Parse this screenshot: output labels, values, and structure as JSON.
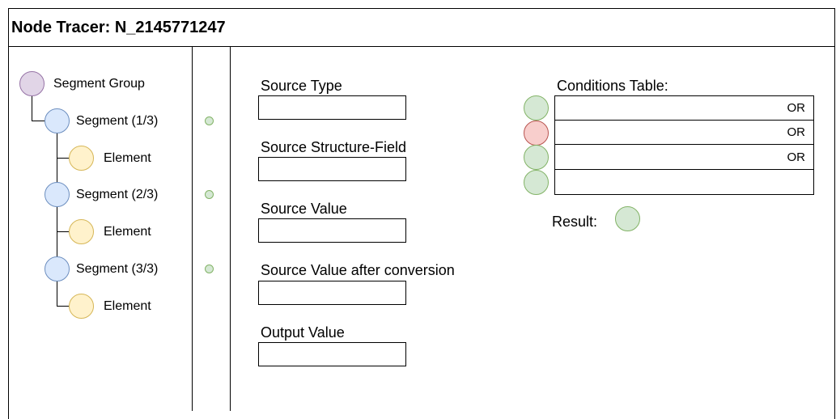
{
  "title": "Node Tracer: N_2145771247",
  "tree": {
    "group": {
      "label": "Segment Group",
      "color": "#e1d5e7",
      "icon": "group-node-icon"
    },
    "segments": [
      {
        "label": "Segment (1/3)",
        "element_label": "Element",
        "status": "green"
      },
      {
        "label": "Segment (2/3)",
        "element_label": "Element",
        "status": "green"
      },
      {
        "label": "Segment (3/3)",
        "element_label": "Element",
        "status": "green"
      }
    ]
  },
  "fields": [
    {
      "label": "Source Type",
      "value": ""
    },
    {
      "label": "Source Structure-Field",
      "value": ""
    },
    {
      "label": "Source Value",
      "value": ""
    },
    {
      "label": "Source Value after conversion",
      "value": ""
    },
    {
      "label": "Output Value",
      "value": ""
    }
  ],
  "conditions": {
    "title": "Conditions Table:",
    "rows": [
      {
        "operator": "OR",
        "status": "green"
      },
      {
        "operator": "OR",
        "status": "red"
      },
      {
        "operator": "OR",
        "status": "green"
      },
      {
        "operator": "",
        "status": "green"
      }
    ]
  },
  "result": {
    "label": "Result:",
    "status": "green"
  },
  "colors": {
    "group": "#e1d5e7",
    "segment": "#dae8fc",
    "element": "#fff2cc",
    "pass": "#d5e8d4",
    "fail": "#f8cecc"
  }
}
